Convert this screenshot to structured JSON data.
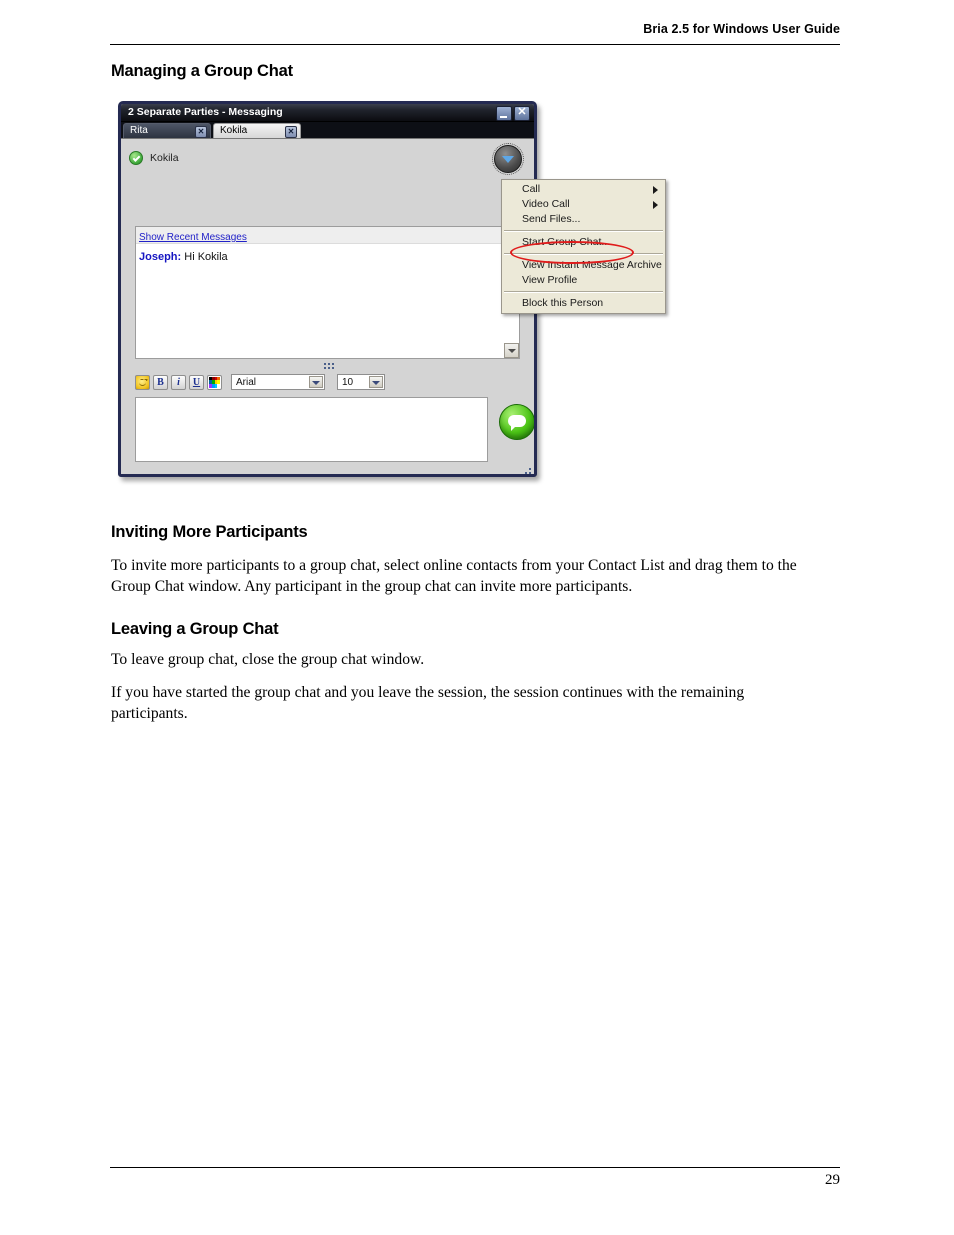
{
  "document": {
    "header_title": "Bria 2.5 for Windows User Guide",
    "page_number": "29",
    "sections": {
      "managing_heading": "Managing a Group Chat",
      "inviting_heading": "Inviting More Participants",
      "inviting_body": "To invite more participants to a group chat, select online contacts from your Contact List and drag them to the Group Chat window. Any participant in the group chat can invite more participants.",
      "leaving_heading": "Leaving a Group Chat",
      "leaving_body_1": "To leave group chat, close the group chat window.",
      "leaving_body_2": "If you have started the group chat and you leave the session, the session continues with the remaining participants."
    }
  },
  "screenshot": {
    "window": {
      "title": "2 Separate Parties - Messaging",
      "minimize_label": "–",
      "close_label": "✕",
      "tabs": [
        {
          "label": "Rita",
          "close_label": "✕",
          "active": false
        },
        {
          "label": "Kokila",
          "close_label": "✕",
          "active": true
        }
      ],
      "contact": {
        "name": "Kokila",
        "status_icon": "online-check-icon"
      },
      "options_button_icon": "chevron-down-icon",
      "message_panel": {
        "recent_link": "Show Recent Messages",
        "messages": [
          {
            "sender": "Joseph:",
            "text": " Hi Kokila"
          }
        ],
        "scroll_down_icon": "scroll-down-arrow-icon"
      },
      "compose": {
        "toolbar": [
          {
            "name": "emoticon-icon",
            "label": ""
          },
          {
            "name": "bold-icon",
            "label": "B"
          },
          {
            "name": "italic-icon",
            "label": "i"
          },
          {
            "name": "underline-icon",
            "label": "U"
          },
          {
            "name": "font-color-palette-icon",
            "label": ""
          }
        ],
        "font_family": "Arial",
        "font_size": "10",
        "input_value": "",
        "send_button_icon": "speech-bubble-send-icon"
      }
    },
    "context_menu": {
      "items": [
        {
          "label": "Call",
          "submenu": true,
          "separator_after": false
        },
        {
          "label": "Video Call",
          "submenu": true,
          "separator_after": false
        },
        {
          "label": "Send Files...",
          "submenu": false,
          "separator_after": true
        },
        {
          "label": "Start Group Chat...",
          "submenu": false,
          "separator_after": true,
          "highlighted": true
        },
        {
          "label": "View Instant Message Archive",
          "submenu": false,
          "separator_after": false
        },
        {
          "label": "View Profile",
          "submenu": false,
          "separator_after": true
        },
        {
          "label": "Block this Person",
          "submenu": false,
          "separator_after": false
        }
      ]
    }
  },
  "colors": {
    "highlight_ring": "#e01b1b",
    "menu_background": "#ece9d8",
    "link": "#2222c8",
    "sender": "#1616c2",
    "status_online": "#3da83a"
  }
}
